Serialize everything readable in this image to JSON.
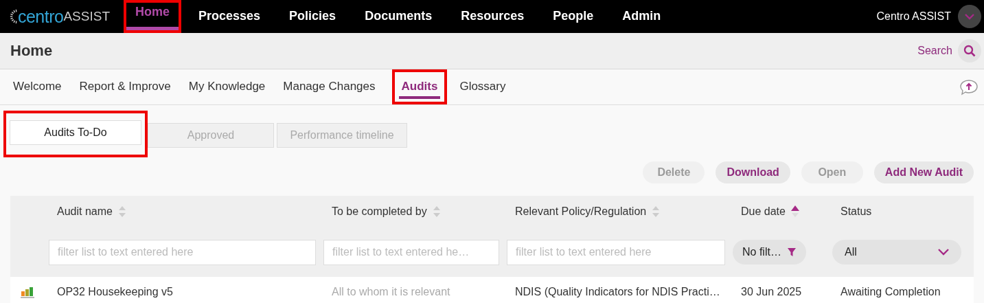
{
  "logo": {
    "part_1": "centro",
    "part_2": "ASSIST"
  },
  "nav": [
    {
      "label": "Home",
      "selected": true,
      "highlighted": true
    },
    {
      "label": "Processes",
      "selected": false,
      "highlighted": false
    },
    {
      "label": "Policies",
      "selected": false,
      "highlighted": false
    },
    {
      "label": "Documents",
      "selected": false,
      "highlighted": false
    },
    {
      "label": "Resources",
      "selected": false,
      "highlighted": false
    },
    {
      "label": "People",
      "selected": false,
      "highlighted": false
    },
    {
      "label": "Admin",
      "selected": false,
      "highlighted": false
    }
  ],
  "user": {
    "name": "Centro ASSIST"
  },
  "page": {
    "title": "Home",
    "search": "Search"
  },
  "subnav": [
    {
      "label": "Welcome",
      "selected": false,
      "highlighted": false
    },
    {
      "label": "Report & Improve",
      "selected": false,
      "highlighted": false
    },
    {
      "label": "My Knowledge",
      "selected": false,
      "highlighted": false
    },
    {
      "label": "Manage Changes",
      "selected": false,
      "highlighted": false
    },
    {
      "label": "Audits",
      "selected": true,
      "highlighted": true
    },
    {
      "label": "Glossary",
      "selected": false,
      "highlighted": false
    }
  ],
  "tabs": [
    {
      "label": "Audits To-Do",
      "selected": true,
      "highlighted": true
    },
    {
      "label": "Approved",
      "selected": false,
      "highlighted": false
    },
    {
      "label": "Performance timeline",
      "selected": false,
      "highlighted": false
    }
  ],
  "actions": [
    {
      "label": "Delete",
      "disabled": true
    },
    {
      "label": "Download",
      "disabled": false
    },
    {
      "label": "Open",
      "disabled": true
    },
    {
      "label": "Add New Audit",
      "disabled": false
    }
  ],
  "table": {
    "columns": [
      {
        "label": "Audit name",
        "sortable": true,
        "sorted_ascending": false,
        "filter": {
          "kind": "text",
          "placeholder": "filter list to text entered here"
        }
      },
      {
        "label": "To be completed by",
        "sortable": true,
        "sorted_ascending": false,
        "filter": {
          "kind": "text",
          "placeholder": "filter list to text entered he…"
        }
      },
      {
        "label": "Relevant Policy/Regulation",
        "sortable": true,
        "sorted_ascending": false,
        "filter": {
          "kind": "text",
          "placeholder": "filter list to text entered here"
        }
      },
      {
        "label": "Due date",
        "sortable": true,
        "sorted_ascending": true,
        "filter": {
          "kind": "funnel",
          "value": "No filt…"
        }
      },
      {
        "label": "Status",
        "sortable": false,
        "filter": {
          "kind": "select",
          "value": "All"
        }
      }
    ],
    "rows": [
      {
        "cells": [
          "OP32 Housekeeping v5",
          "All to whom it is relevant",
          "NDIS (Quality Indicators for NDIS Practi…",
          "30 Jun 2025",
          "Awaiting Completion"
        ]
      }
    ]
  }
}
